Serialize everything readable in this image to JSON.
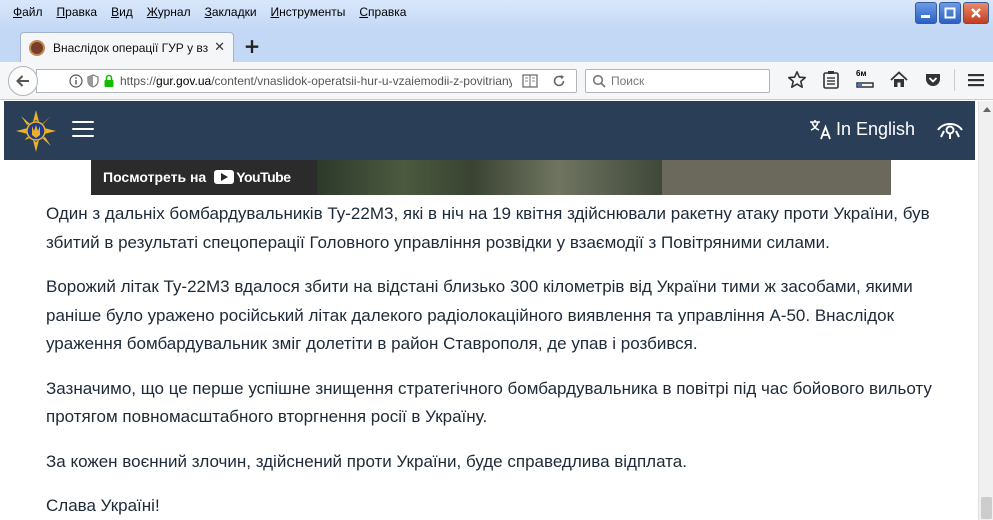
{
  "menu": {
    "items": [
      "Файл",
      "Правка",
      "Вид",
      "Журнал",
      "Закладки",
      "Инструменты",
      "Справка"
    ]
  },
  "tab": {
    "title": "Внаслідок операції ГУР у вз...",
    "close_glyph": "✕",
    "new_tab_glyph": "+"
  },
  "navbar": {
    "url_scheme": "https://",
    "url_host": "gur.gov.ua",
    "url_path": "/content/vnaslidok-operatsii-hur-u-vzaiemodii-z-povitrianymy-s",
    "search_placeholder": "Поиск",
    "downloads_badge": "6м"
  },
  "site": {
    "lang_icon_glyph": "文A",
    "lang_label": "In English"
  },
  "video": {
    "watch_label": "Посмотреть на",
    "brand": "YouTube"
  },
  "article": {
    "paragraphs": [
      "Один з дальніх бомбардувальників Ту-22М3, які в ніч на 19 квітня здійснювали ракетну атаку проти України, був збитий в результаті спецоперації Головного управління розвідки у взаємодії з Повітряними силами.",
      "Ворожий літак Ту-22М3 вдалося збити на відстані близько 300 кілометрів від України тими ж засобами, якими раніше було уражено російський літак далекого радіолокаційного виявлення та управління А-50. Внаслідок ураження бомбардувальник зміг долетіти в район Ставрополя, де упав і розбився.",
      "Зазначимо, що це перше успішне знищення стратегічного бомбардувальника в повітрі під час бойового вильоту протягом повномасштабного вторгнення росії в Україну.",
      "За кожен воєнний злочин, здійснений проти України, буде справедлива відплата.",
      "Слава Україні!"
    ]
  },
  "colors": {
    "site_header_bg": "#2a3f57",
    "article_text": "#1e2a38",
    "os_chrome": "#c3d8f5"
  }
}
